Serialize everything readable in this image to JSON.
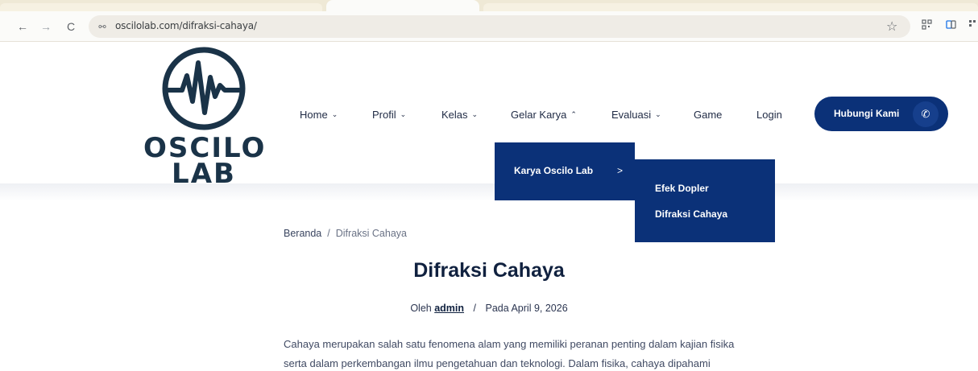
{
  "browser": {
    "url": "oscilolab.com/difraksi-cahaya/",
    "back_icon": "←",
    "forward_icon": "→",
    "reload_icon": "C",
    "site_info_icon": "⚯",
    "star_icon": "☆"
  },
  "logo": {
    "line1": "OSCILO",
    "line2": "LAB"
  },
  "nav": {
    "items": [
      {
        "label": "Home",
        "chevron": "⌄"
      },
      {
        "label": "Profil",
        "chevron": "⌄"
      },
      {
        "label": "Kelas",
        "chevron": "⌄"
      },
      {
        "label": "Gelar Karya",
        "chevron": "⌃"
      },
      {
        "label": "Evaluasi",
        "chevron": "⌄"
      },
      {
        "label": "Game"
      },
      {
        "label": "Login"
      }
    ],
    "cta_label": "Hubungi Kami",
    "cta_icon": "✆"
  },
  "dropdown": {
    "level1": "Karya Oscilo Lab",
    "level1_arrow": ">",
    "level2": [
      "Efek Dopler",
      "Difraksi Cahaya"
    ]
  },
  "breadcrumb": {
    "home": "Beranda",
    "separator": "/",
    "current": "Difraksi Cahaya"
  },
  "article": {
    "title": "Difraksi Cahaya",
    "by_prefix": "Oleh",
    "author": "admin",
    "separator": "/",
    "date": "Pada April 9, 2026",
    "para_line1": "Cahaya merupakan salah satu fenomena alam yang memiliki peranan penting dalam kajian fisika",
    "para_line2": "serta dalam perkembangan ilmu pengetahuan dan teknologi. Dalam fisika, cahaya dipahami"
  },
  "colors": {
    "brand": "#0b3178",
    "logo": "#1a3348"
  }
}
